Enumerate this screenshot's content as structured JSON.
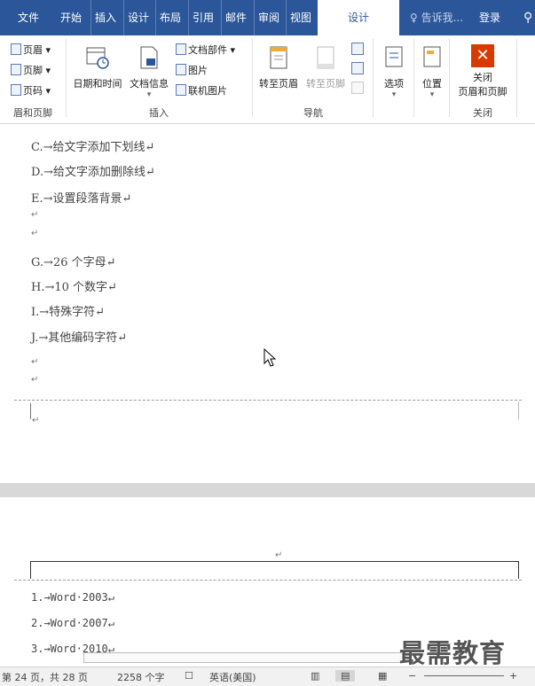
{
  "tabs": [
    "文件",
    "开始",
    "插入",
    "设计",
    "布局",
    "引用",
    "邮件",
    "审阅",
    "视图",
    "设计"
  ],
  "tell_me": "告诉我...",
  "login": "登录",
  "share_icon": "person-icon",
  "ribbon": {
    "header_footer_group": {
      "items": [
        "页眉",
        "页脚",
        "页码"
      ],
      "label": "眉和页脚"
    },
    "insert_group": {
      "datetime": "日期和时间",
      "docinfo": "文档信息",
      "docparts": "文档部件",
      "picture": "图片",
      "online_picture": "联机图片",
      "label": "插入"
    },
    "nav_group": {
      "goto_header": "转至页眉",
      "goto_footer": "转至页脚",
      "label": "导航"
    },
    "options": "选项",
    "position": "位置",
    "close_group": {
      "close_line1": "关闭",
      "close_line2": "页眉和页脚",
      "label": "关闭"
    }
  },
  "doc": {
    "lines": [
      {
        "text": "C.→给文字添加下划线↵"
      },
      {
        "text": "D.→给文字添加删除线↵"
      },
      {
        "text": "E.→设置段落背景↵"
      },
      {
        "text": "↵"
      },
      {
        "text": "↵"
      },
      {
        "text": "G.→26 个字母↵"
      },
      {
        "text": "H.→10 个数字↵"
      },
      {
        "text": "I.→特殊字符↵"
      },
      {
        "text": "J.→其他编码字符↵"
      },
      {
        "text": "↵"
      },
      {
        "text": "↵"
      }
    ],
    "footer_mark": "↵",
    "header_mark": "↵",
    "body_lines": [
      "1.→Word·2003↵",
      "2.→Word·2007↵",
      "3.→Word·2010↵"
    ]
  },
  "status": {
    "page": "第 24 页，共 28 页",
    "words": "2258 个字",
    "lang": "英语(美国)"
  },
  "watermark": "最需教育",
  "colors": {
    "ribbon_blue": "#2b579a",
    "close_red": "#d83b01"
  }
}
